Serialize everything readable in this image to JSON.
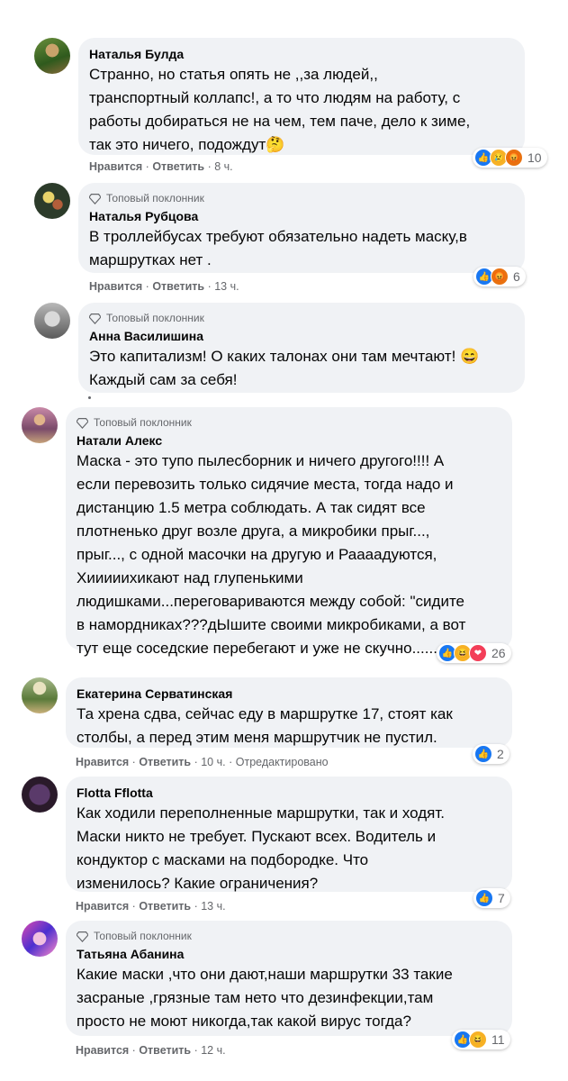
{
  "badge_label": "Топовый поклонник",
  "actions": {
    "like": "Нравится",
    "reply": "Ответить",
    "sep": "·"
  },
  "comments": [
    {
      "author": "Наталья Булда",
      "text": "Странно, но статья опять не ,,за людей,,\nтранспортный коллапс!, а то что людям на работу, с\nработы добираться не на чем, тем паче, дело к зиме,\nтак это ничего, подождут🤔",
      "time": "8 ч.",
      "reactions": [
        "like",
        "sad",
        "angry"
      ],
      "count": "10"
    },
    {
      "author": "Наталья Рубцова",
      "text": "В троллейбусах требуют обязательно надеть маску,в\nмаршрутках нет .",
      "time": "13 ч.",
      "reactions": [
        "like",
        "angry"
      ],
      "count": "6"
    },
    {
      "author": "Анна Василишина",
      "text": "Это капитализм! О каких талонах они там мечтают! 😄\nКаждый сам за себя!"
    },
    {
      "author": "Натали Алекс",
      "text": "Маска - это тупо пылесборник и ничего другого!!!! А\nесли перевозить только сидячие места, тогда надо и\nдистанцию 1.5 метра соблюдать. А так сидят все\nплотненько друг возле друга, а микробики прыг...,\nпрыг..., с одной масочки на другую и Раааадуются,\nХииииихикают над глупенькими\nлюдишками...переговариваются между собой: \"сидите\nв намордниках???дЫшите своими микробиками, а вот\nтут еще соседские перебегают и уже не скучно......",
      "reactions": [
        "like",
        "haha",
        "love"
      ],
      "count": "26"
    },
    {
      "author": "Екатерина Серватинская",
      "text": "Та хрена сдва, сейчас еду в маршрутке 17, стоят как\nстолбы, а перед этим меня маршрутчик не пустил.",
      "time": "10 ч.",
      "edited": "Отредактировано",
      "reactions": [
        "like"
      ],
      "count": "2"
    },
    {
      "author": "Flotta Fflotta",
      "text": "Как ходили переполненные маршрутки, так и ходят.\nМаски никто не требует. Пускают всех. Водитель и\nкондуктор с масками на подбородке. Что\nизменилось? Какие ограничения?",
      "time": "13 ч.",
      "reactions": [
        "like"
      ],
      "count": "7"
    },
    {
      "author": "Татьяна Абанина",
      "text": "Какие маски ,что они дают,наши маршрутки 33 такие\nзасраные ,грязные там нето что дезинфекции,там\nпросто не моют никогда,так какой вирус тогда?",
      "time": "12 ч.",
      "reactions": [
        "like",
        "haha"
      ],
      "count": "11"
    }
  ]
}
